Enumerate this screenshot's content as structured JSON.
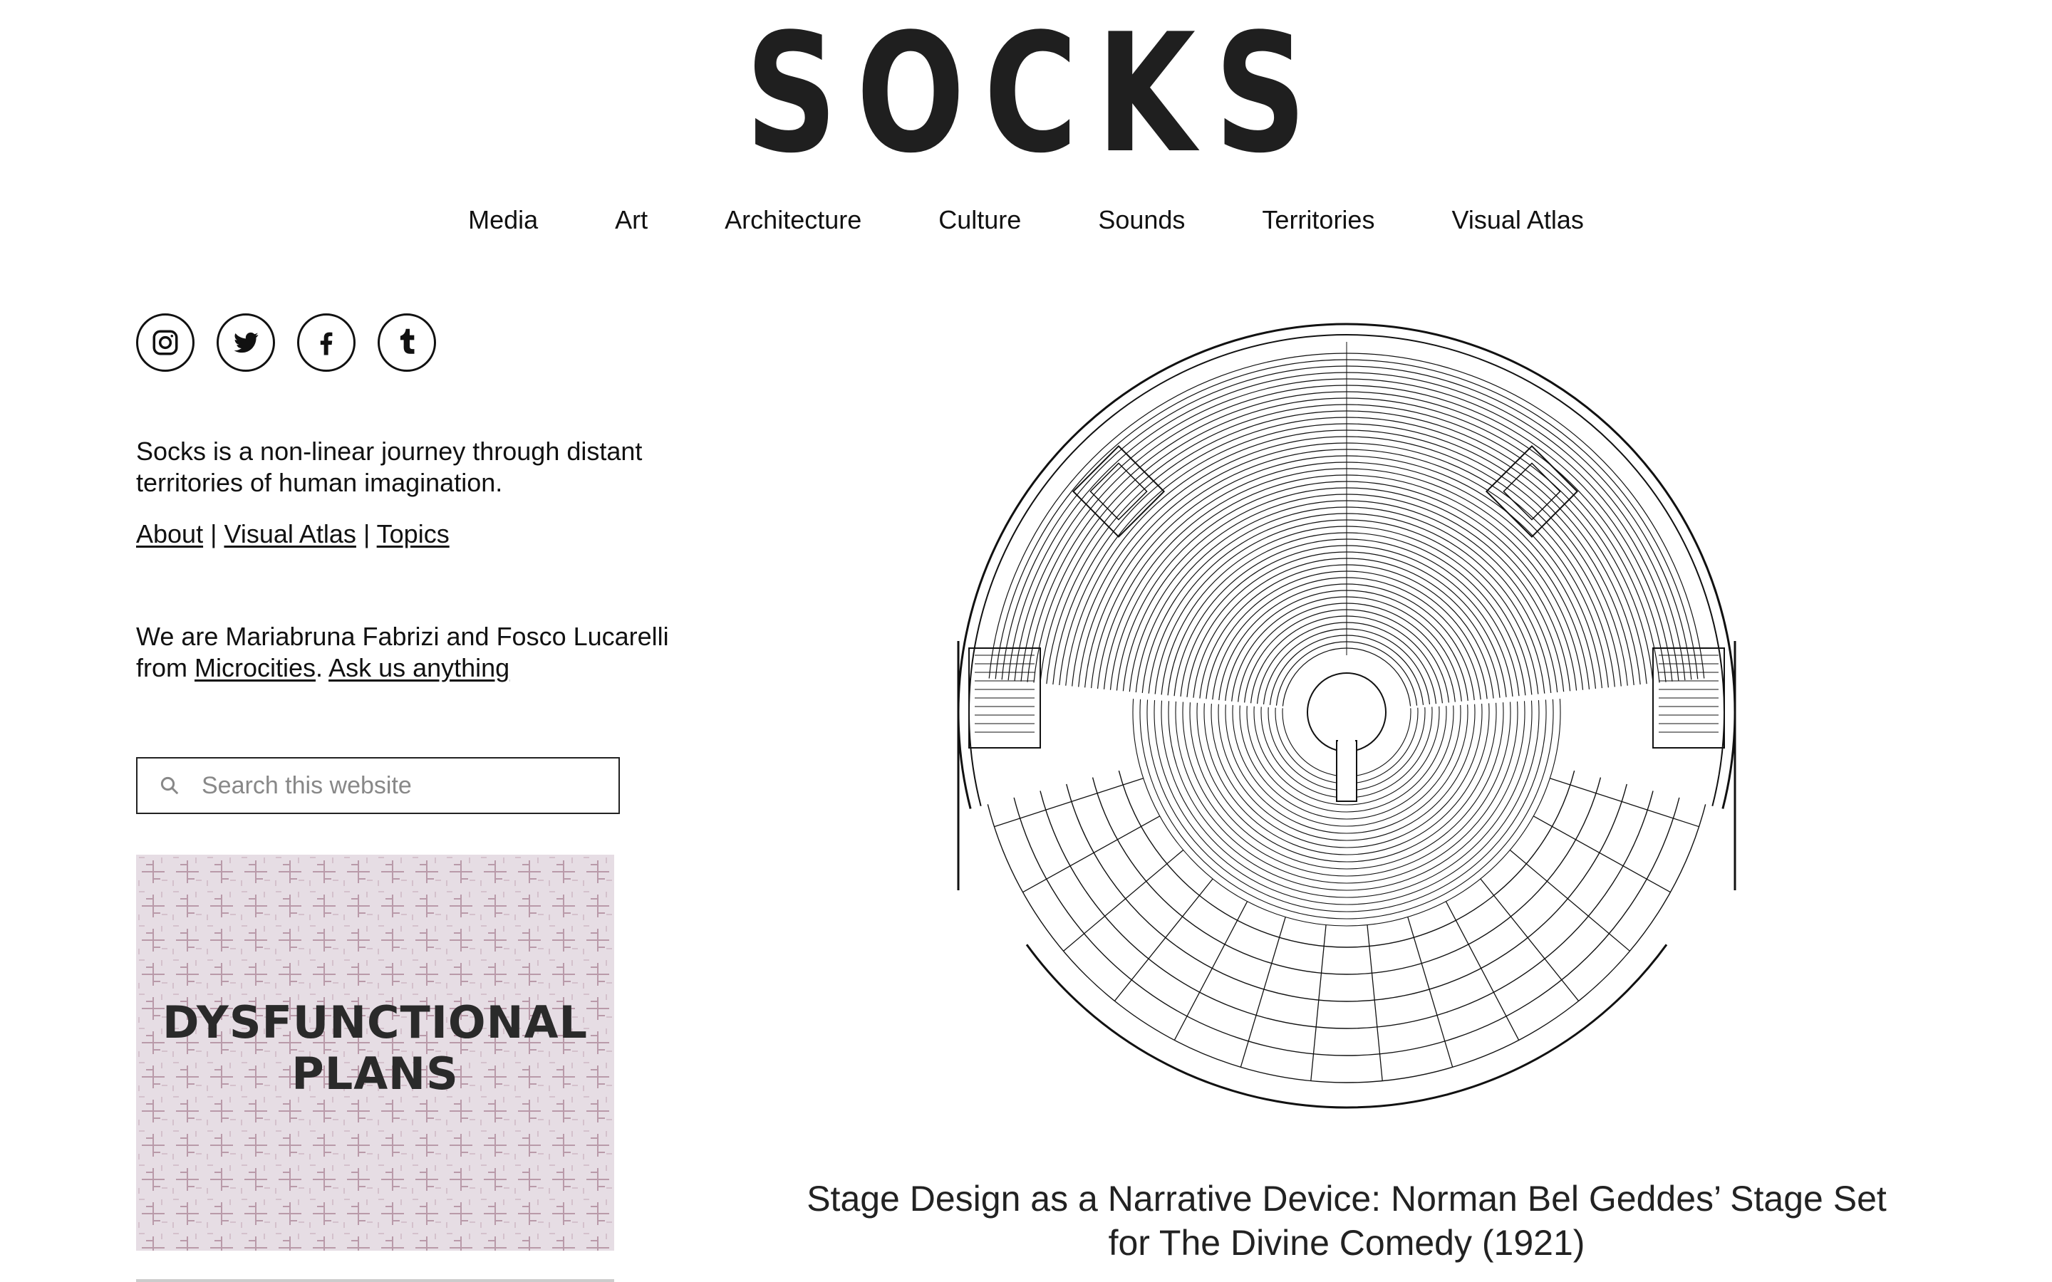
{
  "site": {
    "logo": "SOCKS"
  },
  "nav": {
    "items": [
      {
        "label": "Media"
      },
      {
        "label": "Art"
      },
      {
        "label": "Architecture"
      },
      {
        "label": "Culture"
      },
      {
        "label": "Sounds"
      },
      {
        "label": "Territories"
      },
      {
        "label": "Visual Atlas"
      }
    ]
  },
  "social": {
    "icons": [
      "instagram-icon",
      "twitter-icon",
      "facebook-icon",
      "tumblr-icon"
    ]
  },
  "sidebar": {
    "tagline": "Socks is a non-linear journey through distant territories of human imagination.",
    "links": [
      {
        "label": "About"
      },
      {
        "label": "Visual Atlas"
      },
      {
        "label": "Topics"
      }
    ],
    "separator": "|",
    "authors_prefix": "We are Mariabruna Fabrizi and Fosco Lucarelli from ",
    "authors_link": "Microcities",
    "authors_dot": ". ",
    "ask_link": "Ask us anything",
    "search_placeholder": "Search this website",
    "promo": {
      "line1": "DYSFUNCTIONAL",
      "line2": "PLANS"
    }
  },
  "article": {
    "title": "Stage Design as a Narrative Device: Norman Bel Geddes’ Stage Set for The Divine Comedy (1921)"
  },
  "colors": {
    "text": "#111111",
    "promo_bg": "#e6dde4"
  }
}
